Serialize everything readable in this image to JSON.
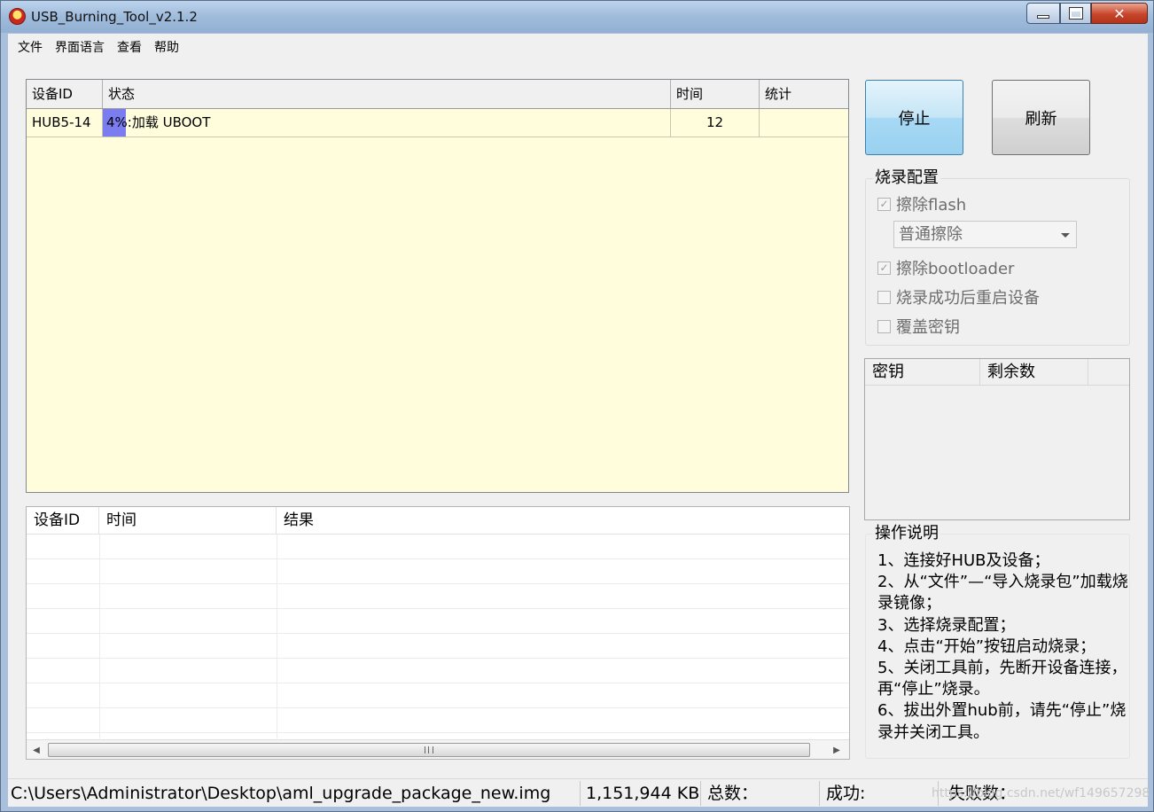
{
  "window": {
    "title": "USB_Burning_Tool_v2.1.2"
  },
  "menu": [
    "文件",
    "界面语言",
    "查看",
    "帮助"
  ],
  "device_table": {
    "columns": [
      "设备ID",
      "状态",
      "时间",
      "统计"
    ],
    "rows": [
      {
        "device_id": "HUB5-14",
        "progress_label": "4%",
        "progress": 0.04,
        "status": ":加载 UBOOT",
        "time": "12",
        "stats": ""
      }
    ]
  },
  "buttons": {
    "stop": "停止",
    "refresh": "刷新"
  },
  "burn_config": {
    "title": "烧录配置",
    "erase_flash": {
      "label": "擦除flash",
      "checked": true,
      "enabled": false
    },
    "erase_mode": "普通擦除",
    "erase_bootloader": {
      "label": "擦除bootloader",
      "checked": true,
      "enabled": false
    },
    "reboot_after": {
      "label": "烧录成功后重启设备",
      "checked": false,
      "enabled": false
    },
    "overwrite_key": {
      "label": "覆盖密钥",
      "checked": false,
      "enabled": false
    }
  },
  "key_table": {
    "columns": [
      "密钥",
      "剩余数"
    ]
  },
  "log_table": {
    "columns": [
      "设备ID",
      "时间",
      "结果"
    ]
  },
  "instructions": {
    "title": "操作说明",
    "lines": [
      "1、连接好HUB及设备；",
      "2、从“文件”—“导入烧录包”加载烧录镜像；",
      "3、选择烧录配置；",
      "4、点击“开始”按钮启动烧录；",
      "5、关闭工具前，先断开设备连接，再“停止”烧录。",
      "6、拔出外置hub前，请先“停止”烧录并关闭工具。"
    ]
  },
  "statusbar": {
    "path": "C:\\Users\\Administrator\\Desktop\\aml_upgrade_package_new.img",
    "size": "1,151,944 KB",
    "total_label": "总数：",
    "success_label": "成功:",
    "fail_label": "失败数：",
    "watermark": "https://blog.csdn.net/wf149657298"
  },
  "colors": {
    "titlebar": "#9fbbdb",
    "device_list_bg": "#fffddc",
    "progress": "#7b7cf0",
    "stop_button": "#a7d9f5"
  }
}
